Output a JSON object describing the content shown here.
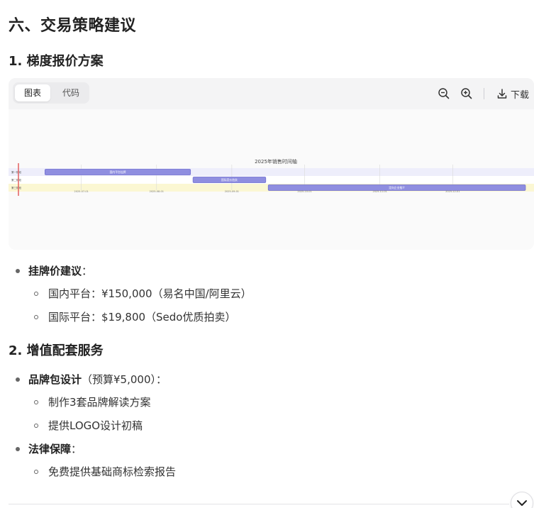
{
  "headings": {
    "section6": "六、交易策略建议",
    "sub1": "1. 梯度报价方案",
    "sub2": "2. 增值配套服务"
  },
  "card": {
    "tab_chart": "图表",
    "tab_code": "代码",
    "download_label": "下载",
    "active_tab": "图表"
  },
  "chart_data": {
    "type": "gantt",
    "title": "2025年销售时间轴",
    "rows": [
      "第一阶段",
      "第二阶段",
      "第三阶段"
    ],
    "tasks": [
      {
        "label": "国内平台挂牌",
        "row": 0,
        "start": "2025-06-16",
        "end": "2025-08-15"
      },
      {
        "label": "国际竞价拍卖",
        "row": 1,
        "start": "2025-08-16",
        "end": "2025-09-15"
      },
      {
        "label": "定向企业推介",
        "row": 2,
        "start": "2025-09-16",
        "end": "2025-12-31"
      }
    ],
    "x_ticks": [
      "2025-07-01",
      "2025-08-01",
      "2025-09-01",
      "2025-10-01",
      "2025-11-01",
      "2025-12-01"
    ],
    "today_marker": "2025-06-01",
    "colors": {
      "bar": "#8f8ee0",
      "bar_border": "#6f6dd0",
      "band_a": "#eeeefb",
      "band_b": "#fbf7d3",
      "today": "#e25555"
    }
  },
  "list1": [
    {
      "title": "挂牌价建议",
      "suffix": "：",
      "children": [
        "国内平台：¥150,000（易名中国/阿里云）",
        "国际平台：$19,800（Sedo优质拍卖）"
      ]
    }
  ],
  "list2": [
    {
      "title": "品牌包设计",
      "suffix": "（预算¥5,000）：",
      "children": [
        "制作3套品牌解读方案",
        "提供LOGO设计初稿"
      ]
    },
    {
      "title": "法律保障",
      "suffix": "：",
      "children": [
        "免费提供基础商标检索报告"
      ]
    }
  ],
  "icons": {
    "zoom_out": "zoom-out-icon",
    "zoom_in": "zoom-in-icon",
    "download": "download-icon",
    "scroll_down": "chevron-down-icon"
  }
}
